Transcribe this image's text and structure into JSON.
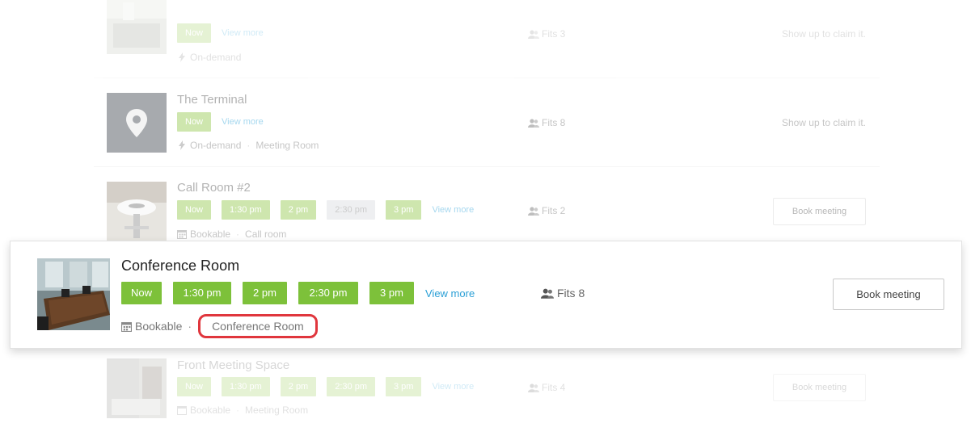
{
  "rows": [
    {
      "title": "",
      "slots": [
        "Now"
      ],
      "view_more": "View more",
      "meta": [
        "On-demand"
      ],
      "fits": "Fits 3",
      "action": "Show up to claim it."
    },
    {
      "title": "The Terminal",
      "slots": [
        "Now"
      ],
      "view_more": "View more",
      "meta": [
        "On-demand",
        "Meeting Room"
      ],
      "fits": "Fits 8",
      "action": "Show up to claim it."
    },
    {
      "title": "Call Room #2",
      "slots": [
        "Now",
        "1:30 pm",
        "2 pm",
        "2:30 pm",
        "3 pm"
      ],
      "view_more": "View more",
      "meta": [
        "Bookable",
        "Call room"
      ],
      "fits": "Fits 2",
      "action": "Book meeting"
    },
    {
      "title": "Front Meeting Space",
      "slots": [
        "Now",
        "1:30 pm",
        "2 pm",
        "2:30 pm",
        "3 pm"
      ],
      "view_more": "View more",
      "meta": [
        "Bookable",
        "Meeting Room"
      ],
      "fits": "Fits 4",
      "action": "Book meeting"
    }
  ],
  "featured": {
    "title": "Conference Room",
    "slots": [
      "Now",
      "1:30 pm",
      "2 pm",
      "2:30 pm",
      "3 pm"
    ],
    "view_more": "View more",
    "meta_type": "Bookable",
    "meta_category": "Conference Room",
    "fits": "Fits 8",
    "action": "Book meeting"
  },
  "colors": {
    "slot_green": "#7dc13a",
    "link_blue": "#2a9fd6",
    "highlight_red": "#e0363d",
    "unavailable_grey": "#d7dbe0"
  },
  "icons": {
    "on_demand": "lightning-icon",
    "bookable": "calendar-icon",
    "capacity": "people-icon",
    "placeholder": "location-pin-icon"
  }
}
